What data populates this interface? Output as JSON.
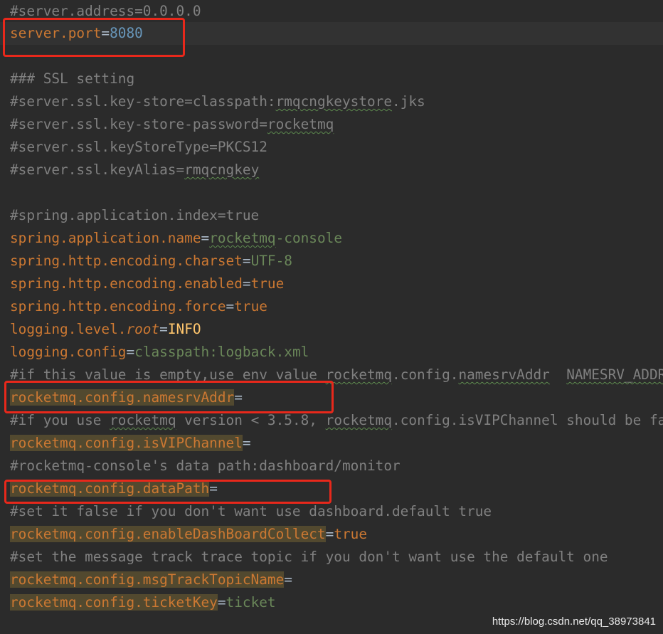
{
  "lines": {
    "l0": {
      "text": "#server.address=0.0.0.0"
    },
    "l1": {
      "key": "server.port",
      "eq": "=",
      "value": "8080"
    },
    "l3": {
      "text": "### SSL setting"
    },
    "l4": {
      "a": "#server.ssl.key-store=classpath:",
      "b": "rmqcngkeystore",
      "c": ".jks"
    },
    "l5": {
      "a": "#server.ssl.key-store-password=",
      "b": "rocketmq"
    },
    "l6": {
      "text": "#server.ssl.keyStoreType=PKCS12"
    },
    "l7": {
      "a": "#server.ssl.keyAlias=",
      "b": "rmqcngkey"
    },
    "l9": {
      "text": "#spring.application.index=true"
    },
    "l10": {
      "key": "spring.application.name",
      "eq": "=",
      "v1": "rocketmq",
      "v2": "-console"
    },
    "l11": {
      "key": "spring.http.encoding.charset",
      "eq": "=",
      "value": "UTF-8"
    },
    "l12": {
      "key": "spring.http.encoding.enabled",
      "eq": "=",
      "value": "true"
    },
    "l13": {
      "key": "spring.http.encoding.force",
      "eq": "=",
      "value": "true"
    },
    "l14": {
      "k1": "logging.level.",
      "k2": "root",
      "eq": "=",
      "value": "INFO"
    },
    "l15": {
      "key": "logging.config",
      "eq": "=",
      "value": "classpath:logback.xml"
    },
    "l16": {
      "a": "#if this value is empty,use env value ",
      "b": "rocketmq",
      "c": ".config.",
      "d": "namesrvAddr",
      "e": "  ",
      "f": "NAMESRV_ADDR"
    },
    "l17": {
      "key": "rocketmq.config.namesrvAddr",
      "eq": "="
    },
    "l18": {
      "a": "#if you use ",
      "b": "rocketmq",
      "c": " version < 3.5.8, ",
      "d": "rocketmq",
      "e": ".config.isVIPChannel should be false."
    },
    "l19": {
      "key": "rocketmq.config.isVIPChannel",
      "eq": "="
    },
    "l20": {
      "text": "#rocketmq-console's data path:dashboard/monitor"
    },
    "l21": {
      "key": "rocketmq.config.dataPath",
      "eq": "="
    },
    "l22": {
      "text": "#set it false if you don't want use dashboard.default true"
    },
    "l23": {
      "key": "rocketmq.config.enableDashBoardCollect",
      "eq": "=",
      "value": "true"
    },
    "l24": {
      "text": "#set the message track trace topic if you don't want use the default one"
    },
    "l25": {
      "key": "rocketmq.config.msgTrackTopicName",
      "eq": "="
    },
    "l26": {
      "key": "rocketmq.config.ticketKey",
      "eq": "=",
      "value": "ticket"
    }
  },
  "watermark": "https://blog.csdn.net/qq_38973841",
  "colors": {
    "background": "#2b2b2b",
    "comment": "#808080",
    "key": "#cc7832",
    "number": "#6897bb",
    "string": "#6a8759",
    "highlight_box": "#e8281b"
  }
}
